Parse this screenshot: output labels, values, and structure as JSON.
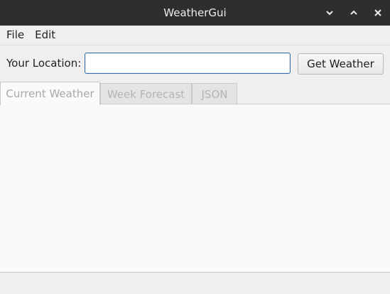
{
  "window": {
    "title": "WeatherGui",
    "controls": [
      "chevron-down-icon",
      "chevron-up-icon",
      "close-icon"
    ]
  },
  "menu": {
    "file": "File",
    "edit": "Edit"
  },
  "location": {
    "label": "Your Location:",
    "value": "",
    "placeholder": ""
  },
  "actions": {
    "get_weather": "Get Weather"
  },
  "tabs": [
    {
      "label": "Current Weather",
      "active": true
    },
    {
      "label": "Week Forecast",
      "active": false
    },
    {
      "label": "JSON",
      "active": false
    }
  ],
  "colors": {
    "titlebar": "#2e2e2e",
    "input_focus_border": "#3a6ea8"
  }
}
